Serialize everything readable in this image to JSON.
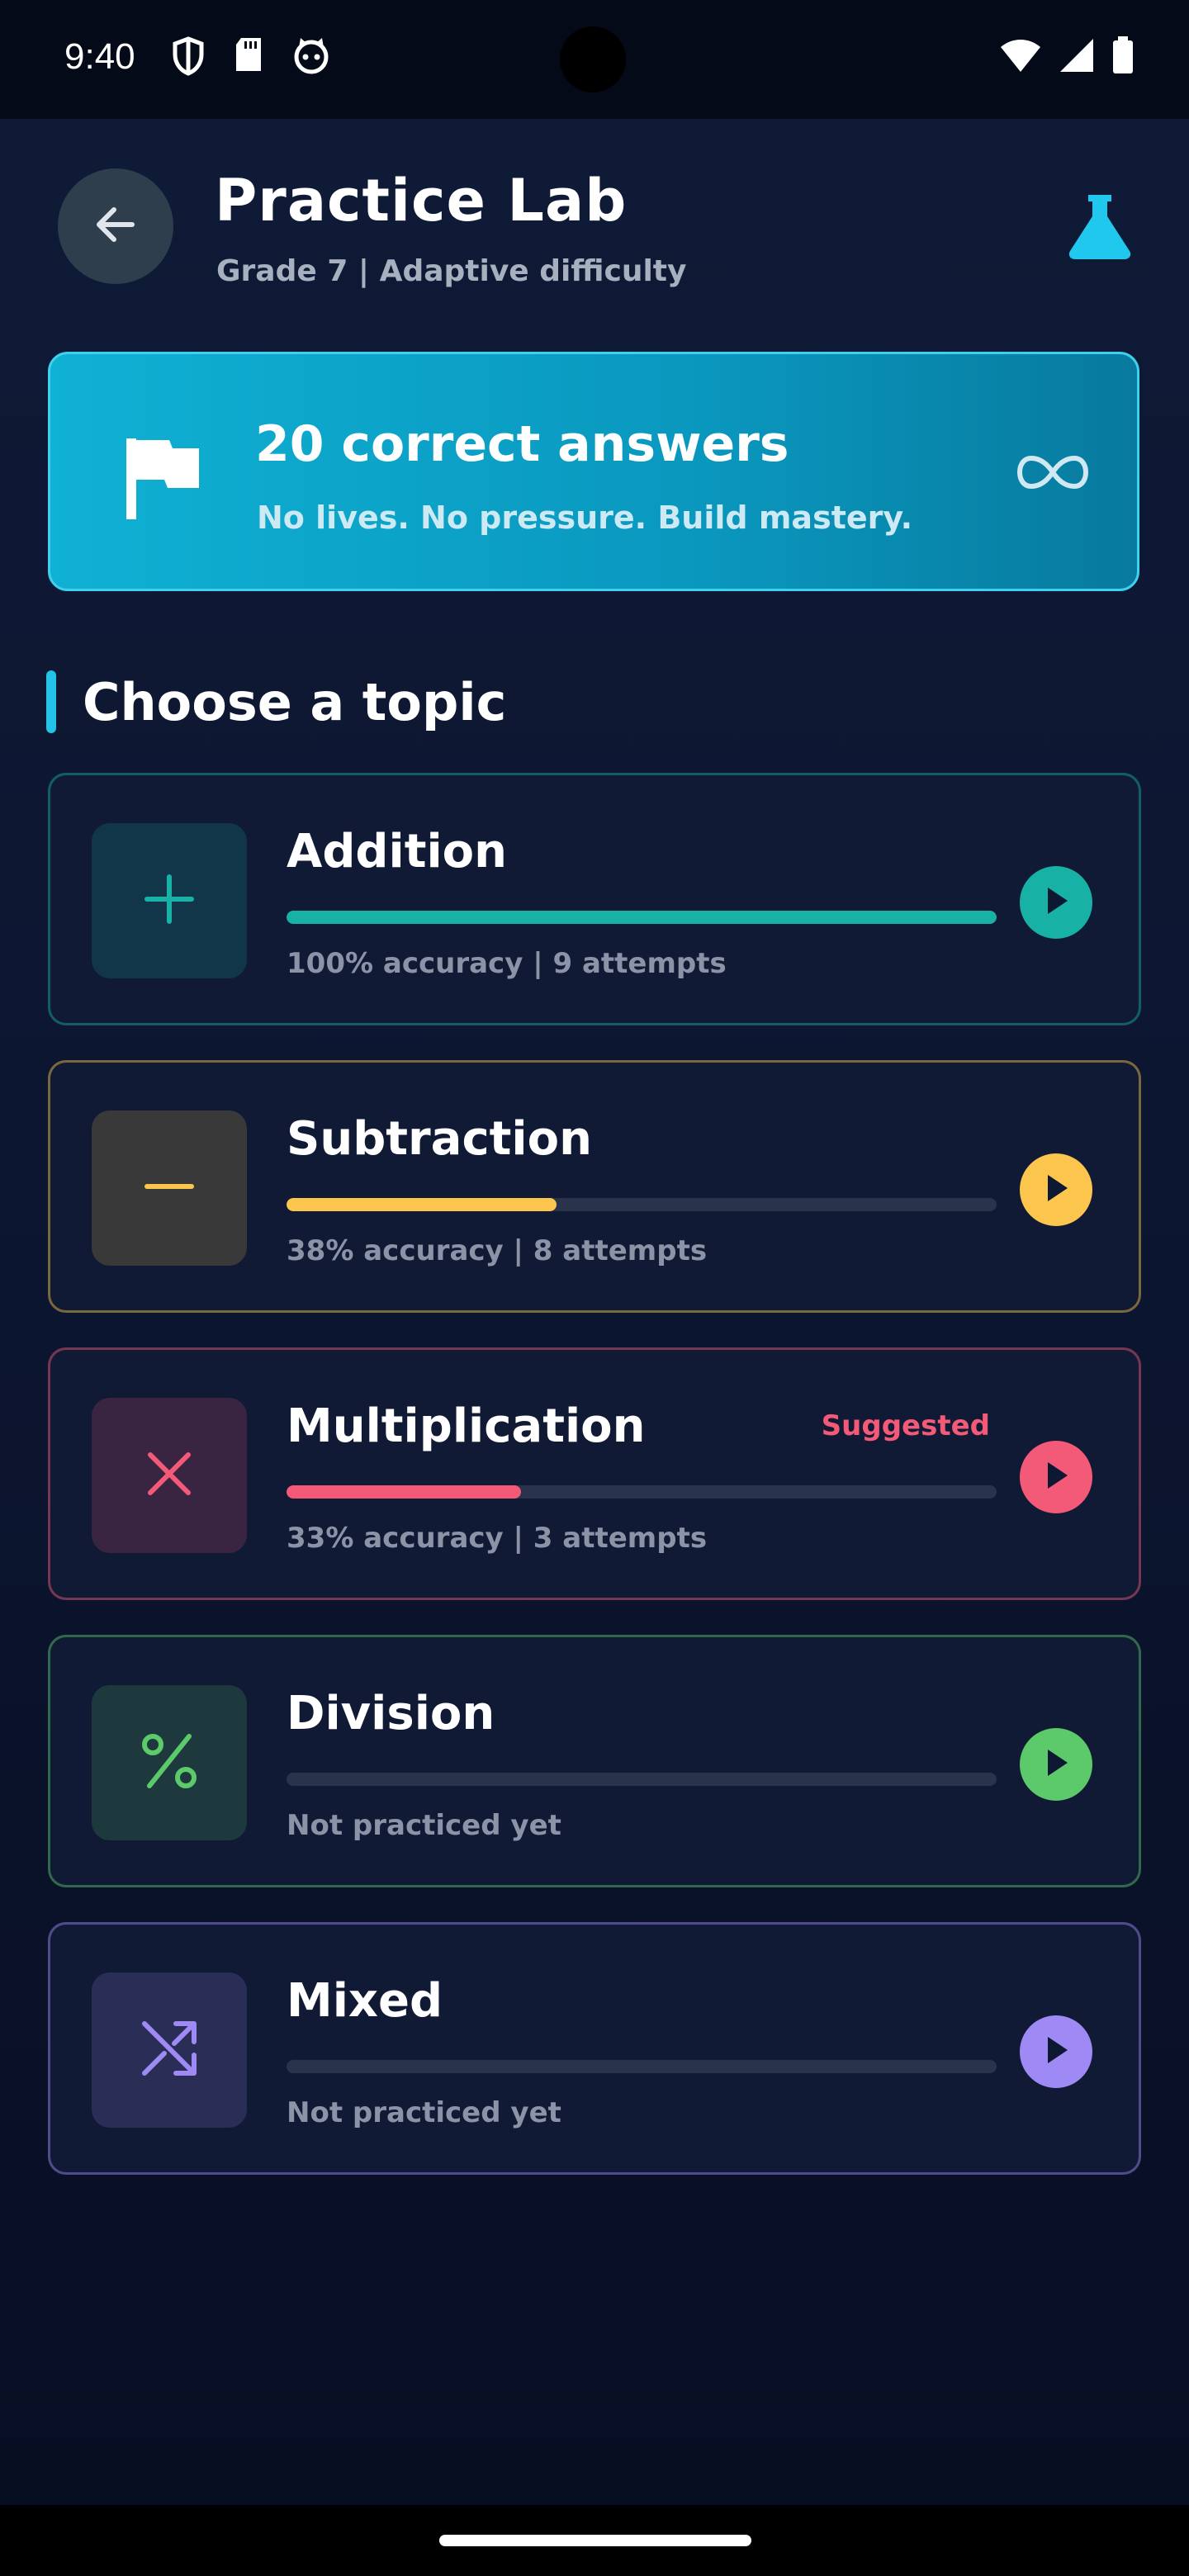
{
  "status_bar": {
    "time": "9:40"
  },
  "header": {
    "title": "Practice Lab",
    "subtitle": "Grade 7 | Adaptive difficulty",
    "back_icon": "arrow-left-icon",
    "lab_icon": "flask-icon"
  },
  "goal": {
    "title": "20 correct answers",
    "subtitle": "No lives. No pressure. Build mastery.",
    "icon": "flag-icon",
    "end_icon": "infinity-icon"
  },
  "section": {
    "title": "Choose a topic"
  },
  "topics": [
    {
      "name": "Addition",
      "stats": "100% accuracy | 9 attempts",
      "progress": 1.0,
      "badge": "",
      "accent": "#17b1a6",
      "icon": "plus-icon"
    },
    {
      "name": "Subtraction",
      "stats": "38% accuracy | 8 attempts",
      "progress": 0.38,
      "badge": "",
      "accent": "#fbc54e",
      "icon": "minus-icon"
    },
    {
      "name": "Multiplication",
      "stats": "33% accuracy | 3 attempts",
      "progress": 0.33,
      "badge": "Suggested",
      "accent": "#f25a78",
      "icon": "times-icon"
    },
    {
      "name": "Division",
      "stats": "Not practiced yet",
      "progress": 0,
      "badge": "",
      "accent": "#5cc96a",
      "icon": "percent-icon"
    },
    {
      "name": "Mixed",
      "stats": "Not practiced yet",
      "progress": 0,
      "badge": "",
      "accent": "#9f8af5",
      "icon": "shuffle-icon"
    }
  ]
}
